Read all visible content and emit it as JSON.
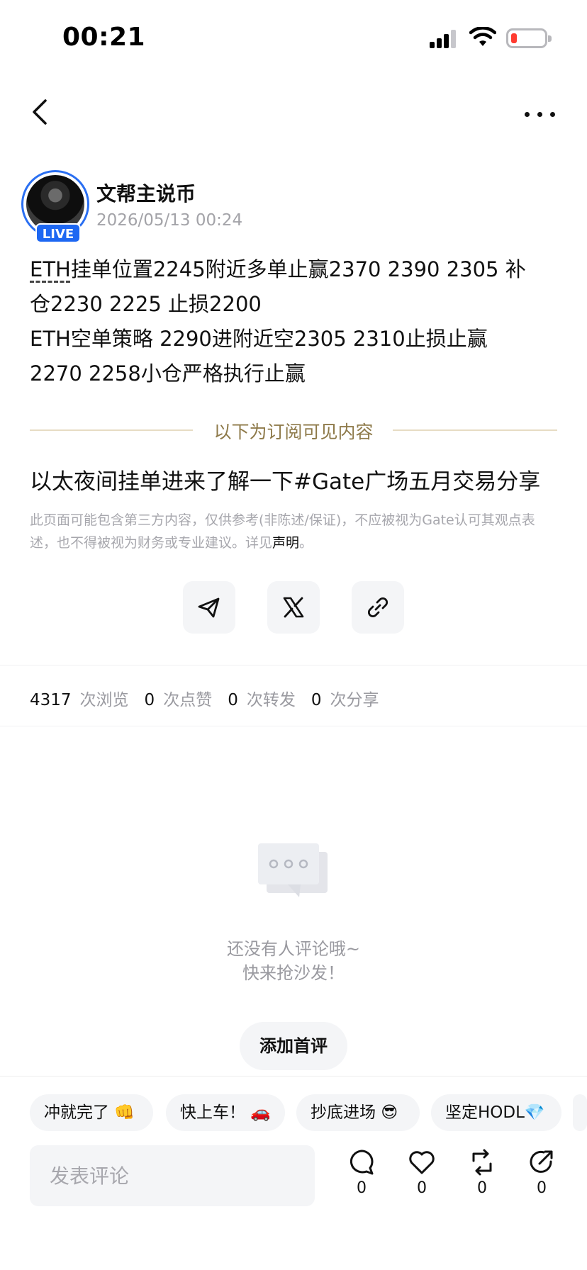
{
  "status_bar": {
    "time": "00:21"
  },
  "author": {
    "name": "文帮主说币",
    "timestamp": "2026/05/13 00:24",
    "live_label": "LIVE"
  },
  "post": {
    "eth_tag": "ETH",
    "line1_rest": "挂单位置2245附近多单止赢2370 2390 2305 补",
    "line2": "仓2230 2225 止损2200",
    "line3": "ETH空单策略 2290进附近空2305 2310止损止赢",
    "line4": "2270 2258小仓严格执行止赢",
    "subscribe_divider": "以下为订阅可见内容",
    "title": "以太夜间挂单进来了解一下#Gate广场五月交易分享",
    "disclaimer": "此页面可能包含第三方内容，仅供参考(非陈述/保证)，不应被视为Gate认可其观点表述，也不得被视为财务或专业建议。详见",
    "disclaimer_link": "声明",
    "disclaimer_end": "。"
  },
  "share": {
    "icons": [
      "telegram-icon",
      "x-icon",
      "link-icon"
    ]
  },
  "stats": {
    "views": "4317",
    "views_label": "次浏览",
    "likes": "0",
    "likes_label": "次点赞",
    "reposts": "0",
    "reposts_label": "次转发",
    "shares": "0",
    "shares_label": "次分享"
  },
  "comments": {
    "empty_line1": "还没有人评论哦~",
    "empty_line2": "快来抢沙发！",
    "first_comment_button": "添加首评"
  },
  "quick_replies": [
    "冲就完了 👊",
    "快上车！ 🚗",
    "抄底进场 😎",
    "坚定HODL💎"
  ],
  "bottom_bar": {
    "input_placeholder": "发表评论",
    "comment_count": "0",
    "like_count": "0",
    "repost_count": "0",
    "share_count": "0"
  },
  "colors": {
    "live_badge": "#1d67f2",
    "divider_text": "#8e7a4a",
    "muted_text": "#9a9aa0",
    "chip_bg": "#f4f5f7"
  }
}
